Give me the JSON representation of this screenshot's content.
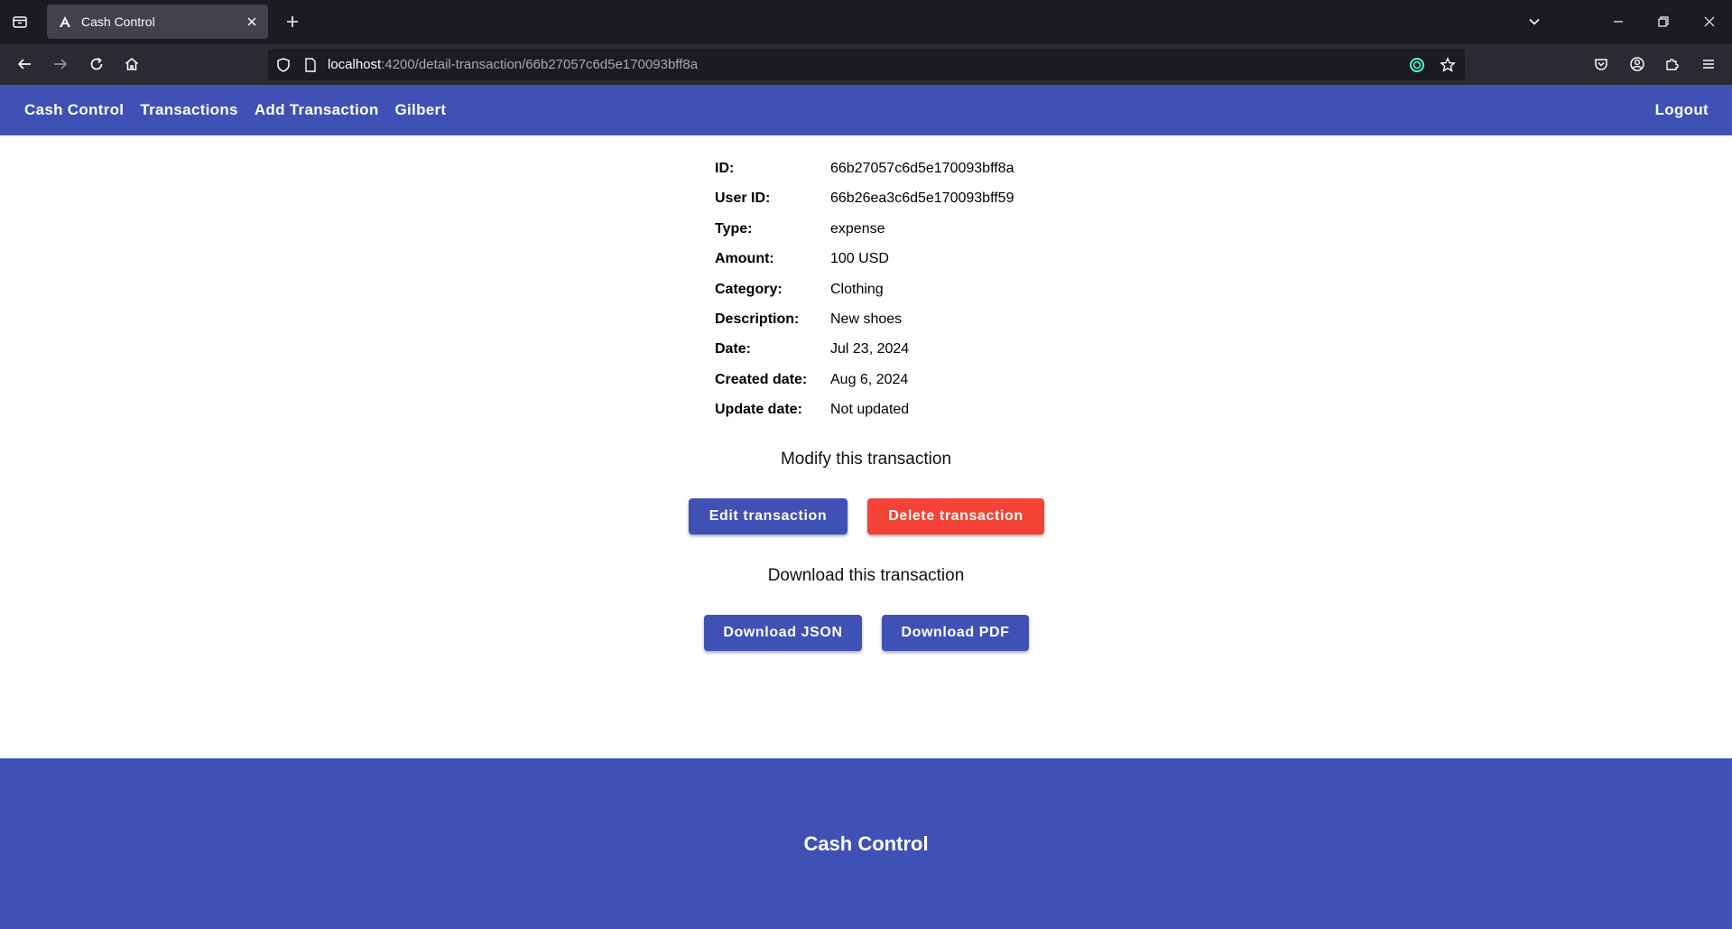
{
  "browser": {
    "tab_title": "Cash Control",
    "url_host": "localhost",
    "url_path": ":4200/detail-transaction/66b27057c6d5e170093bff8a"
  },
  "header": {
    "links": [
      "Cash Control",
      "Transactions",
      "Add Transaction",
      "Gilbert"
    ],
    "logout": "Logout"
  },
  "transaction": {
    "rows": [
      {
        "label": "ID:",
        "value": "66b27057c6d5e170093bff8a"
      },
      {
        "label": "User ID:",
        "value": "66b26ea3c6d5e170093bff59"
      },
      {
        "label": "Type:",
        "value": "expense"
      },
      {
        "label": "Amount:",
        "value": "100 USD"
      },
      {
        "label": "Category:",
        "value": "Clothing"
      },
      {
        "label": "Description:",
        "value": "New shoes"
      },
      {
        "label": "Date:",
        "value": "Jul 23, 2024"
      },
      {
        "label": "Created date:",
        "value": "Aug 6, 2024"
      },
      {
        "label": "Update date:",
        "value": "Not updated"
      }
    ]
  },
  "modify": {
    "title": "Modify this transaction",
    "edit_label": "Edit transaction",
    "delete_label": "Delete transaction"
  },
  "download": {
    "title": "Download this transaction",
    "json_label": "Download JSON",
    "pdf_label": "Download PDF"
  },
  "footer": {
    "title": "Cash Control"
  },
  "colors": {
    "primary": "#3f51b5",
    "warn": "#f44336"
  }
}
